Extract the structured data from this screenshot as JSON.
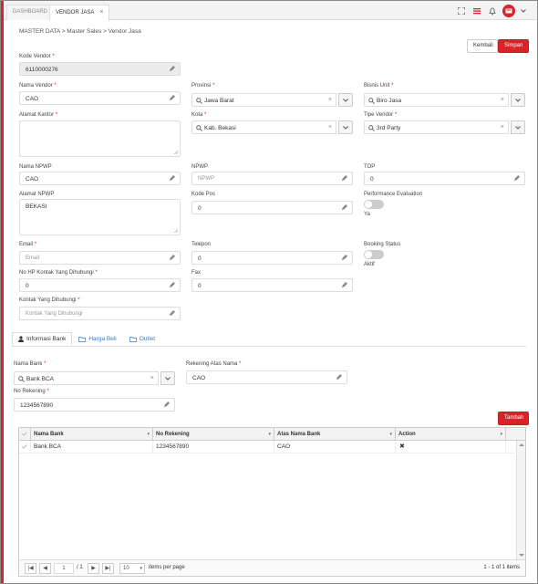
{
  "tabs": [
    {
      "label": "DASHBOARD"
    },
    {
      "label": "VENDOR JASA",
      "close": "×"
    }
  ],
  "breadcrumb": "MASTER DATA > Master Sales > Vendor Jasa",
  "actions": {
    "kembali": "Kembali",
    "simpan": "Simpan"
  },
  "form": {
    "kode_vendor": {
      "label": "Kode Vendor",
      "value": "6110000276"
    },
    "nama_vendor": {
      "label": "Nama Vendor",
      "value": "CAO"
    },
    "provinsi": {
      "label": "Provinsi",
      "value": "Jawa Barat"
    },
    "bisnis_unit": {
      "label": "Bisnis Unit",
      "value": "Biro Jasa"
    },
    "alamat_kantor": {
      "label": "Alamat Kantor",
      "value": ""
    },
    "kota": {
      "label": "Kota",
      "value": "Kab. Bekasi"
    },
    "tipe_vendor": {
      "label": "Tipe Vendor",
      "value": "3rd Party"
    },
    "nama_npwp": {
      "label": "Nama NPWP",
      "value": "CAO"
    },
    "npwp": {
      "label": "NPWP",
      "placeholder": "NPWP"
    },
    "top": {
      "label": "TOP",
      "value": "0"
    },
    "alamat_npwp": {
      "label": "Alamat NPWP",
      "value": "BEKASI"
    },
    "kode_pos": {
      "label": "Kode Pos",
      "value": "0"
    },
    "performance": {
      "label": "Performance Evaluation",
      "state": "Ya"
    },
    "email": {
      "label": "Email",
      "placeholder": "Email"
    },
    "telepon": {
      "label": "Telepon",
      "value": "0"
    },
    "booking": {
      "label": "Booking Status",
      "state": "Aktif"
    },
    "no_hp": {
      "label": "No HP Kontak Yang Dihubungi",
      "value": "0"
    },
    "fax": {
      "label": "Fax",
      "value": "0"
    },
    "kontak": {
      "label": "Kontak Yang Dihubungi",
      "placeholder": "Kontak Yang Dihubungi"
    }
  },
  "subtabs": [
    {
      "label": "Informasi Bank"
    },
    {
      "label": "Harga Beli"
    },
    {
      "label": "Outlet"
    }
  ],
  "bank": {
    "nama_bank": {
      "label": "Nama Bank",
      "value": "Bank BCA"
    },
    "rekening_atas_nama": {
      "label": "Rekening Atas Nama",
      "value": "CAO"
    },
    "no_rekening": {
      "label": "No Rekening",
      "value": "1234567890"
    },
    "tambah": "Tambah"
  },
  "grid": {
    "columns": [
      "Nama Bank",
      "No Rekening",
      "Atas Nama Bank",
      "Action"
    ],
    "rows": [
      {
        "nama_bank": "Bank BCA",
        "no_rekening": "1234567890",
        "atas_nama": "CAO",
        "action": "✖"
      }
    ],
    "pager": {
      "page": "1",
      "of": "/ 1",
      "page_size": "10",
      "per_page_label": "items per page",
      "summary": "1 - 1 of 1 items"
    }
  },
  "colors": {
    "accent": "#d9222a",
    "link": "#3a7ac0"
  }
}
